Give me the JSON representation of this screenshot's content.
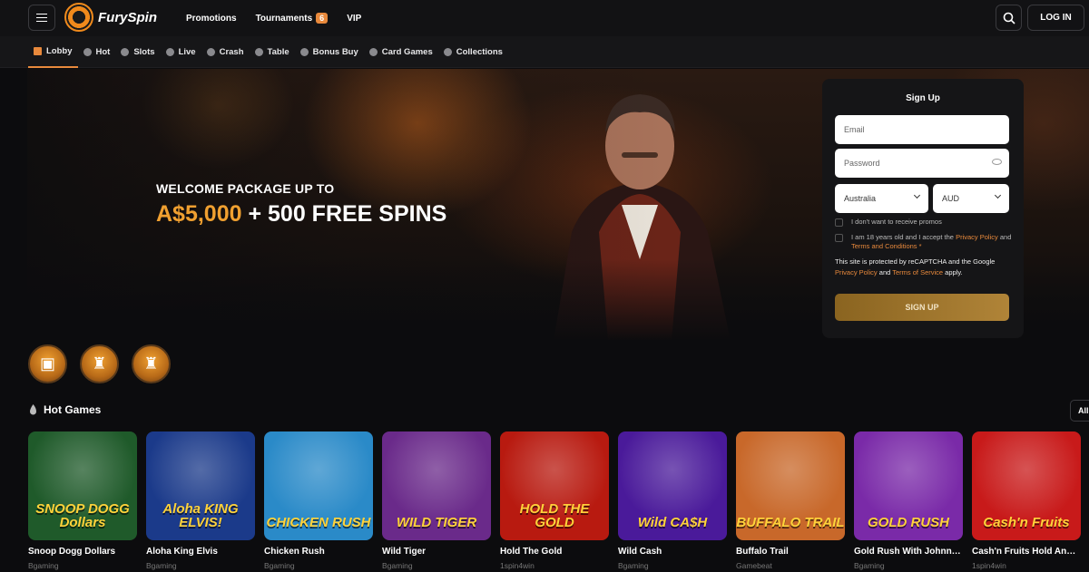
{
  "header": {
    "brand": "FurySpin",
    "nav": [
      {
        "label": "Promotions"
      },
      {
        "label": "Tournaments",
        "badge": "6"
      },
      {
        "label": "VIP"
      }
    ],
    "login_label": "LOG IN"
  },
  "categories": [
    {
      "label": "Lobby",
      "active": true,
      "icon": "grid-icon"
    },
    {
      "label": "Hot",
      "icon": "flame-icon"
    },
    {
      "label": "Slots",
      "icon": "slot-icon"
    },
    {
      "label": "Live",
      "icon": "spade-icon"
    },
    {
      "label": "Crash",
      "icon": "plane-icon"
    },
    {
      "label": "Table",
      "icon": "table-icon"
    },
    {
      "label": "Bonus Buy",
      "icon": "bonus-icon"
    },
    {
      "label": "Card Games",
      "icon": "cards-icon"
    },
    {
      "label": "Collections",
      "icon": "collection-icon"
    }
  ],
  "hero": {
    "subtitle": "WELCOME PACKAGE UP TO",
    "amount": "A$5,000",
    "rest": "+ 500 FREE SPINS"
  },
  "signup": {
    "title": "Sign Up",
    "email_placeholder": "Email",
    "password_placeholder": "Password",
    "country": "Australia",
    "currency": "AUD",
    "promo_opt_out": "I don't want to receive promos",
    "age_text_pre": "I am 18 years old and I accept the ",
    "privacy_link": "Privacy Policy",
    "and": " and ",
    "terms_link": "Terms and Conditions",
    "required_mark": " *",
    "recaptcha_pre": "This site is protected by reCAPTCHA and the Google ",
    "recaptcha_privacy": "Privacy Policy",
    "recaptcha_and": " and ",
    "recaptcha_terms": "Terms of Service",
    "recaptcha_post": " apply.",
    "button": "SIGN UP"
  },
  "hot_games": {
    "title": "Hot Games",
    "all_label": "All",
    "games": [
      {
        "name": "Snoop Dogg Dollars",
        "provider": "Bgaming",
        "art": "SNOOP DOGG Dollars",
        "bg": "#1f5a2a"
      },
      {
        "name": "Aloha King Elvis",
        "provider": "Bgaming",
        "art": "Aloha KING ELVIS!",
        "bg": "#1b3a8a"
      },
      {
        "name": "Chicken Rush",
        "provider": "Bgaming",
        "art": "CHICKEN RUSH",
        "bg": "#2a8ac8"
      },
      {
        "name": "Wild Tiger",
        "provider": "Bgaming",
        "art": "WILD TIGER",
        "bg": "#6a2a8a"
      },
      {
        "name": "Hold The Gold",
        "provider": "1spin4win",
        "art": "HOLD THE GOLD",
        "bg": "#b81a10"
      },
      {
        "name": "Wild Cash",
        "provider": "Bgaming",
        "art": "Wild CA$H",
        "bg": "#4a1a9a"
      },
      {
        "name": "Buffalo Trail",
        "provider": "Gamebeat",
        "art": "BUFFALO TRAIL",
        "bg": "#c8682a"
      },
      {
        "name": "Gold Rush With Johnny Cash",
        "provider": "Bgaming",
        "art": "GOLD RUSH",
        "bg": "#7a2aa8"
      },
      {
        "name": "Cash'n Fruits Hold And Win",
        "provider": "1spin4win",
        "art": "Cash'n Fruits",
        "bg": "#c81a1a"
      }
    ]
  }
}
